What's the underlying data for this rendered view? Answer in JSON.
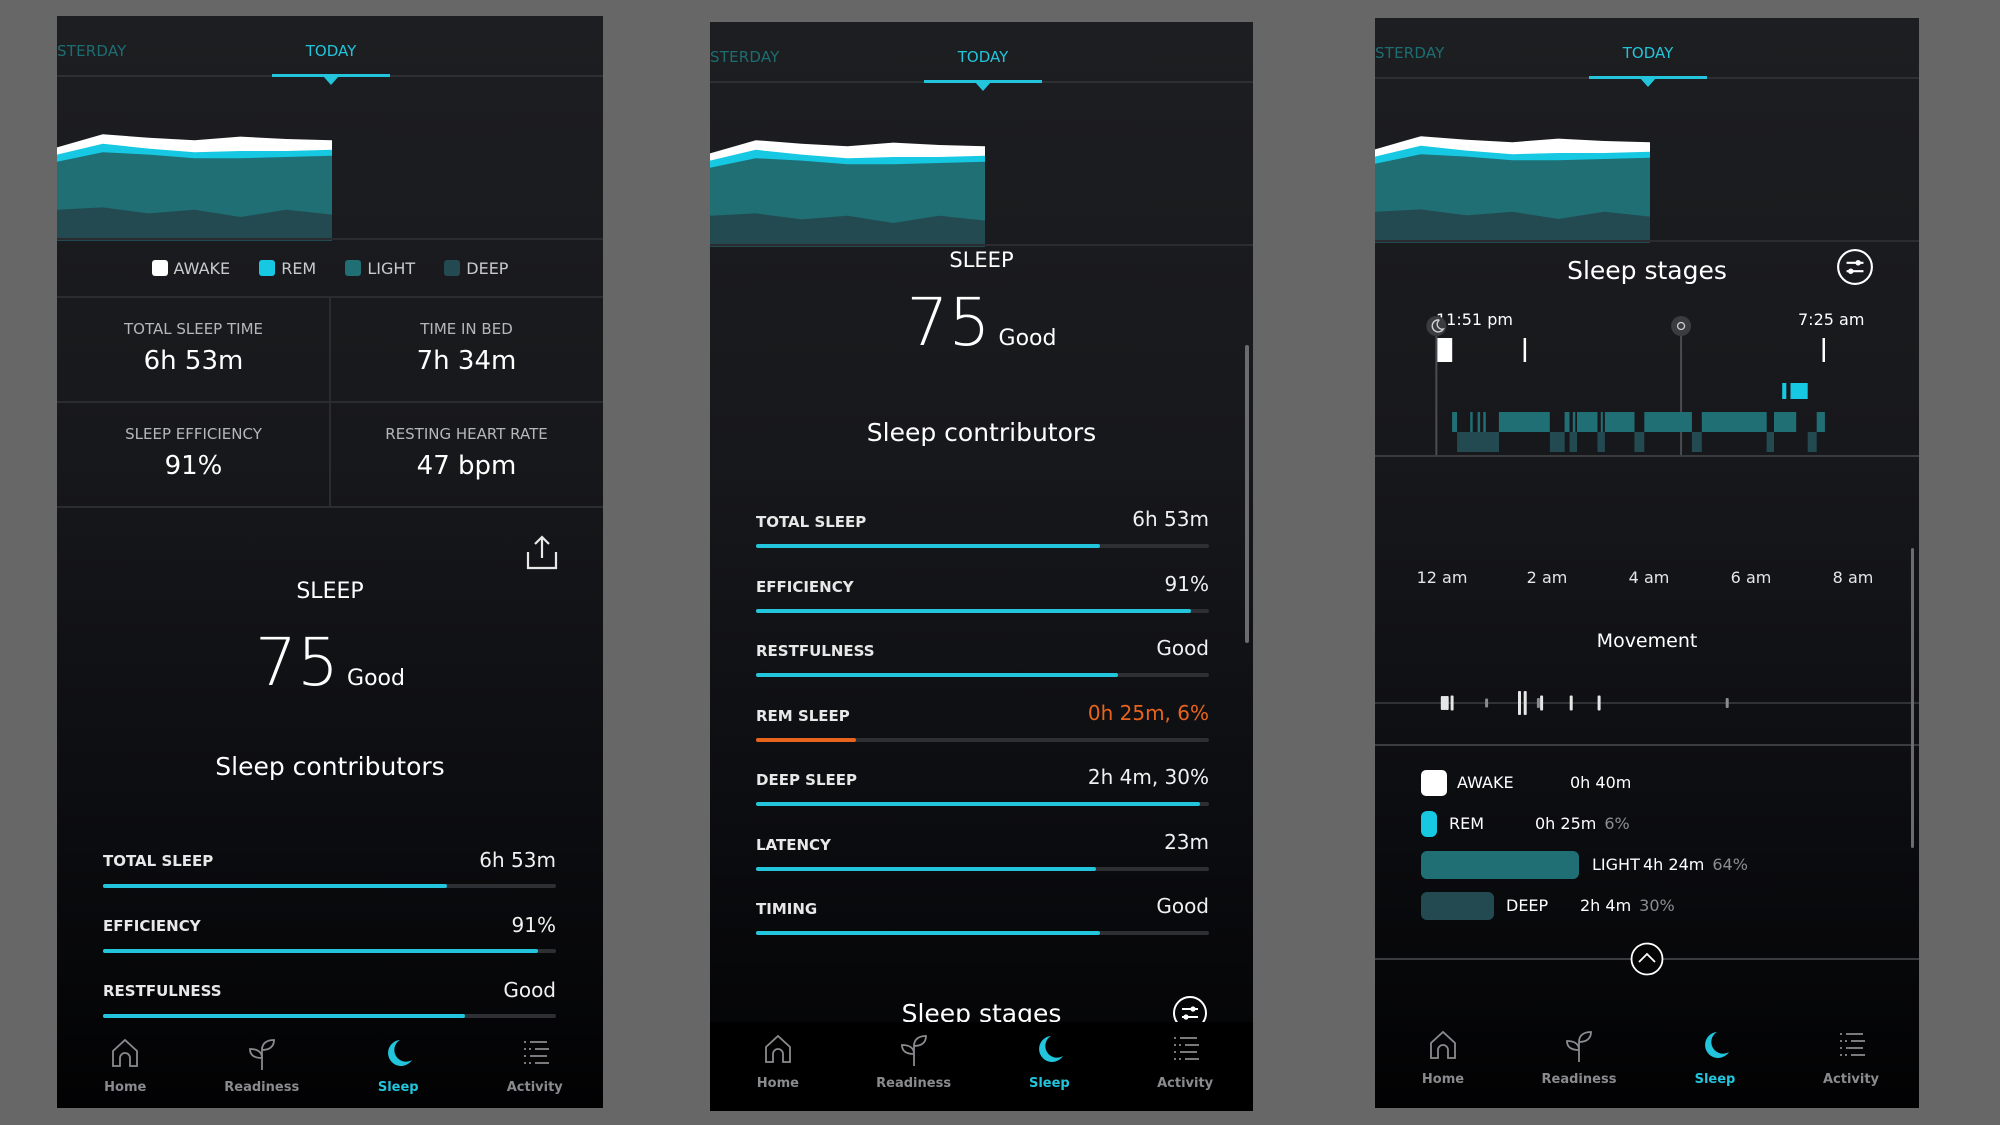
{
  "colors": {
    "accent": "#22c5dc",
    "awake": "#ffffff",
    "rem": "#16c8e2",
    "light": "#1f6f74",
    "deep": "#234a50",
    "warning": "#e8641c",
    "track": "#2d2f33"
  },
  "tabs": {
    "yesterday": "STERDAY",
    "today": "TODAY"
  },
  "legend": [
    {
      "label": "AWAKE",
      "color": "#ffffff"
    },
    {
      "label": "REM",
      "color": "#16c8e2"
    },
    {
      "label": "LIGHT",
      "color": "#1f6f74"
    },
    {
      "label": "DEEP",
      "color": "#234a50"
    }
  ],
  "stats": [
    {
      "label": "TOTAL SLEEP TIME",
      "value": "6h 53m"
    },
    {
      "label": "TIME IN BED",
      "value": "7h 34m"
    },
    {
      "label": "SLEEP EFFICIENCY",
      "value": "91%"
    },
    {
      "label": "RESTING HEART RATE",
      "value": "47 bpm"
    }
  ],
  "score": {
    "title": "SLEEP",
    "value": "75",
    "rating": "Good"
  },
  "contributors_title": "Sleep contributors",
  "contributors": [
    {
      "label": "TOTAL SLEEP",
      "value": "6h 53m",
      "progress": 0.76,
      "warn": false
    },
    {
      "label": "EFFICIENCY",
      "value": "91%",
      "progress": 0.96,
      "warn": false
    },
    {
      "label": "RESTFULNESS",
      "value": "Good",
      "progress": 0.8,
      "warn": false
    },
    {
      "label": "REM SLEEP",
      "value": "0h 25m, 6%",
      "progress": 0.22,
      "warn": true
    },
    {
      "label": "DEEP SLEEP",
      "value": "2h 4m, 30%",
      "progress": 0.98,
      "warn": false
    },
    {
      "label": "LATENCY",
      "value": "23m",
      "progress": 0.75,
      "warn": false
    },
    {
      "label": "TIMING",
      "value": "Good",
      "progress": 0.76,
      "warn": false
    }
  ],
  "stages_title": "Sleep stages",
  "bedtime": "11:51 pm",
  "wake_time": "7:25 am",
  "hour_labels": [
    "12 am",
    "2 am",
    "4 am",
    "6 am",
    "8 am"
  ],
  "movement_title": "Movement",
  "stage_summary": [
    {
      "label": "AWAKE",
      "duration": "0h 40m",
      "percent": ""
    },
    {
      "label": "REM",
      "duration": "0h 25m",
      "percent": "6%"
    },
    {
      "label": "LIGHT",
      "duration": "4h 24m",
      "percent": "64%"
    },
    {
      "label": "DEEP",
      "duration": "2h 4m",
      "percent": "30%"
    }
  ],
  "nav": [
    {
      "label": "Home",
      "icon": "home-icon",
      "active": false
    },
    {
      "label": "Readiness",
      "icon": "sprout-icon",
      "active": false
    },
    {
      "label": "Sleep",
      "icon": "moon-icon",
      "active": true
    },
    {
      "label": "Activity",
      "icon": "list-icon",
      "active": false
    }
  ],
  "chart_data": [
    {
      "type": "area",
      "title": "",
      "x": [
        0,
        1,
        2,
        3,
        4,
        5,
        6
      ],
      "series": [
        {
          "name": "DEEP",
          "values": [
            0.26,
            0.28,
            0.23,
            0.26,
            0.2,
            0.26,
            0.22
          ]
        },
        {
          "name": "LIGHT",
          "values": [
            0.4,
            0.46,
            0.49,
            0.43,
            0.49,
            0.44,
            0.49
          ]
        },
        {
          "name": "REM",
          "values": [
            0.06,
            0.07,
            0.05,
            0.05,
            0.06,
            0.05,
            0.05
          ]
        },
        {
          "name": "AWAKE",
          "values": [
            0.06,
            0.08,
            0.09,
            0.1,
            0.12,
            0.1,
            0.08
          ]
        }
      ],
      "xlabel": "",
      "ylabel": ""
    },
    {
      "type": "hypnogram",
      "title": "Sleep stages",
      "xlabel": "",
      "ylabel": "",
      "x_range_hours": [
        -0.25,
        8.25
      ],
      "tick_labels": [
        "12 am",
        "2 am",
        "4 am",
        "6 am",
        "8 am"
      ],
      "tick_hours": [
        0,
        2,
        4,
        6,
        8
      ],
      "segments_hours": [
        {
          "stage": "awake",
          "start": -0.15,
          "end": 0.03
        },
        {
          "stage": "light",
          "start": 0.03,
          "end": 0.09
        },
        {
          "stage": "deep",
          "start": 0.09,
          "end": 0.6
        },
        {
          "stage": "light",
          "start": 0.25,
          "end": 0.28
        },
        {
          "stage": "light",
          "start": 0.34,
          "end": 0.37
        },
        {
          "stage": "light",
          "start": 0.41,
          "end": 0.44
        },
        {
          "stage": "light",
          "start": 0.6,
          "end": 1.22
        },
        {
          "stage": "awake",
          "start": 0.9,
          "end": 0.93
        },
        {
          "stage": "deep",
          "start": 1.22,
          "end": 1.4
        },
        {
          "stage": "light",
          "start": 1.4,
          "end": 1.46
        },
        {
          "stage": "deep",
          "start": 1.46,
          "end": 1.55
        },
        {
          "stage": "light",
          "start": 1.5,
          "end": 1.53
        },
        {
          "stage": "light",
          "start": 1.55,
          "end": 1.8
        },
        {
          "stage": "deep",
          "start": 1.8,
          "end": 1.89
        },
        {
          "stage": "light",
          "start": 1.84,
          "end": 1.86
        },
        {
          "stage": "light",
          "start": 1.89,
          "end": 2.25
        },
        {
          "stage": "deep",
          "start": 2.25,
          "end": 2.37
        },
        {
          "stage": "light",
          "start": 2.37,
          "end": 2.95
        },
        {
          "stage": "deep",
          "start": 2.95,
          "end": 3.07
        },
        {
          "stage": "light",
          "start": 3.07,
          "end": 3.86
        },
        {
          "stage": "deep",
          "start": 3.86,
          "end": 3.95
        },
        {
          "stage": "light",
          "start": 3.95,
          "end": 4.22
        },
        {
          "stage": "rem",
          "start": 4.05,
          "end": 4.1
        },
        {
          "stage": "rem",
          "start": 4.15,
          "end": 4.36
        },
        {
          "stage": "deep",
          "start": 4.36,
          "end": 4.47
        },
        {
          "stage": "light",
          "start": 4.47,
          "end": 4.57
        },
        {
          "stage": "awake",
          "start": 4.54,
          "end": 4.57
        }
      ],
      "movement_hours": [
        {
          "h": -0.09,
          "size": 1
        },
        {
          "h": -0.06,
          "size": 1
        },
        {
          "h": -0.03,
          "size": 1
        },
        {
          "h": 0.03,
          "size": 1.1
        },
        {
          "h": 0.45,
          "size": 0.5
        },
        {
          "h": 0.85,
          "size": 2
        },
        {
          "h": 0.92,
          "size": 2
        },
        {
          "h": 1.08,
          "size": 0.6
        },
        {
          "h": 1.12,
          "size": 1.1
        },
        {
          "h": 1.48,
          "size": 1.1
        },
        {
          "h": 1.82,
          "size": 1.1
        },
        {
          "h": 3.38,
          "size": 0.6
        }
      ]
    }
  ]
}
